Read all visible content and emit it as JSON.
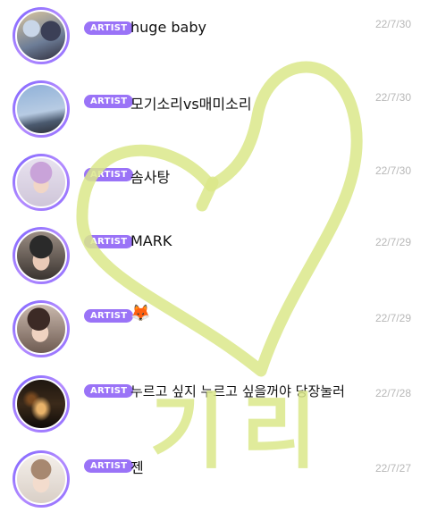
{
  "feed": {
    "badge_label": "ARTIST",
    "items": [
      {
        "title": "huge baby",
        "date": "22/7/30",
        "avatar_icon": "group-photo-avatar"
      },
      {
        "title": "모기소리vs매미소리",
        "date": "22/7/30",
        "avatar_icon": "sky-photo-avatar"
      },
      {
        "title": "솜사탕",
        "date": "22/7/30",
        "avatar_icon": "portrait-avatar"
      },
      {
        "title": "MARK",
        "date": "22/7/29",
        "avatar_icon": "portrait-avatar"
      },
      {
        "title": "🦊",
        "date": "22/7/29",
        "avatar_icon": "portrait-avatar"
      },
      {
        "title": "누르고 싶지 누르고 싶을꺼야 당장눌러",
        "date": "22/7/28",
        "avatar_icon": "concert-photo-avatar"
      },
      {
        "title": "젠",
        "date": "22/7/27",
        "avatar_icon": "portrait-avatar"
      }
    ]
  },
  "overlay": {
    "handwriting": "기리",
    "highlight_color": "#dbe88a"
  }
}
